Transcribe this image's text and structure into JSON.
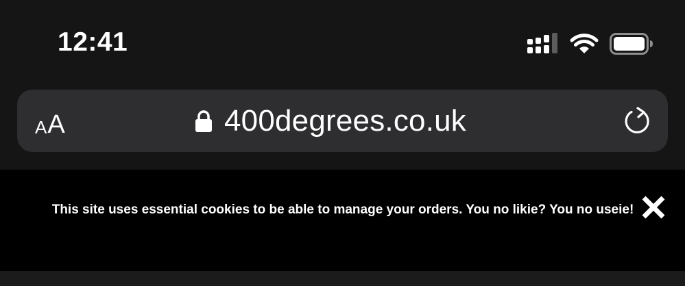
{
  "status_bar": {
    "time": "12:41",
    "icons": [
      "cellular-signal-icon",
      "wifi-icon",
      "battery-icon"
    ]
  },
  "address_bar": {
    "text_size_small": "A",
    "text_size_large": "A",
    "url": "400degrees.co.uk",
    "icons": [
      "lock-icon",
      "reload-icon"
    ]
  },
  "cookie_banner": {
    "message": "This site uses essential cookies to be able to manage your orders. You no likie? You no useie!",
    "close_icon": "close-icon"
  },
  "colors": {
    "background": "#151515",
    "address_bar": "#2e2e30",
    "banner": "#000000",
    "text": "#ffffff"
  }
}
